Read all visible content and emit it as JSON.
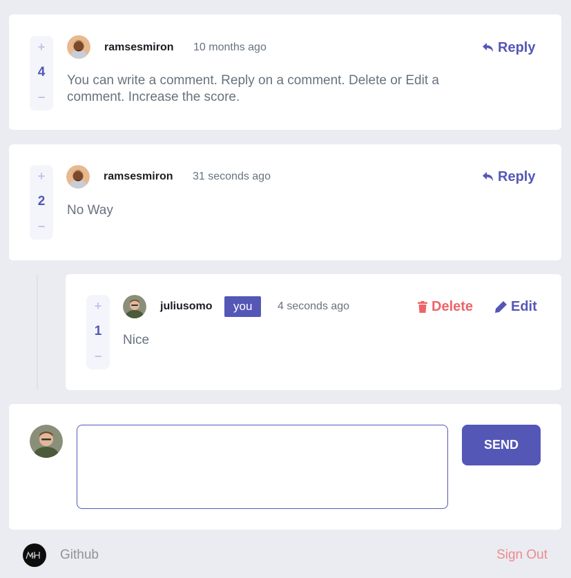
{
  "comments": [
    {
      "username": "ramsesmiron",
      "timestamp": "10 months ago",
      "score": "4",
      "text": "You can write a comment. Reply on a comment. Delete or Edit a comment. Increase the score.",
      "reply_label": "Reply",
      "avatar": "avatar-ramsesmiron"
    },
    {
      "username": "ramsesmiron",
      "timestamp": "31 seconds ago",
      "score": "2",
      "text": "No Way",
      "reply_label": "Reply",
      "avatar": "avatar-ramsesmiron"
    }
  ],
  "reply": {
    "username": "juliusomo",
    "badge": "you",
    "timestamp": "4 seconds ago",
    "score": "1",
    "text": "Nice",
    "delete_label": "Delete",
    "edit_label": "Edit",
    "avatar": "avatar-juliusomo"
  },
  "vote": {
    "plus": "+",
    "minus": "−"
  },
  "new_comment": {
    "placeholder": "",
    "send_label": "SEND"
  },
  "footer": {
    "github_label": "Github",
    "signout_label": "Sign Out",
    "logo": "m4h-logo-icon"
  },
  "colors": {
    "accent": "#5457b6",
    "danger": "#ed6468",
    "background": "#eaecf1",
    "card": "#ffffff"
  }
}
